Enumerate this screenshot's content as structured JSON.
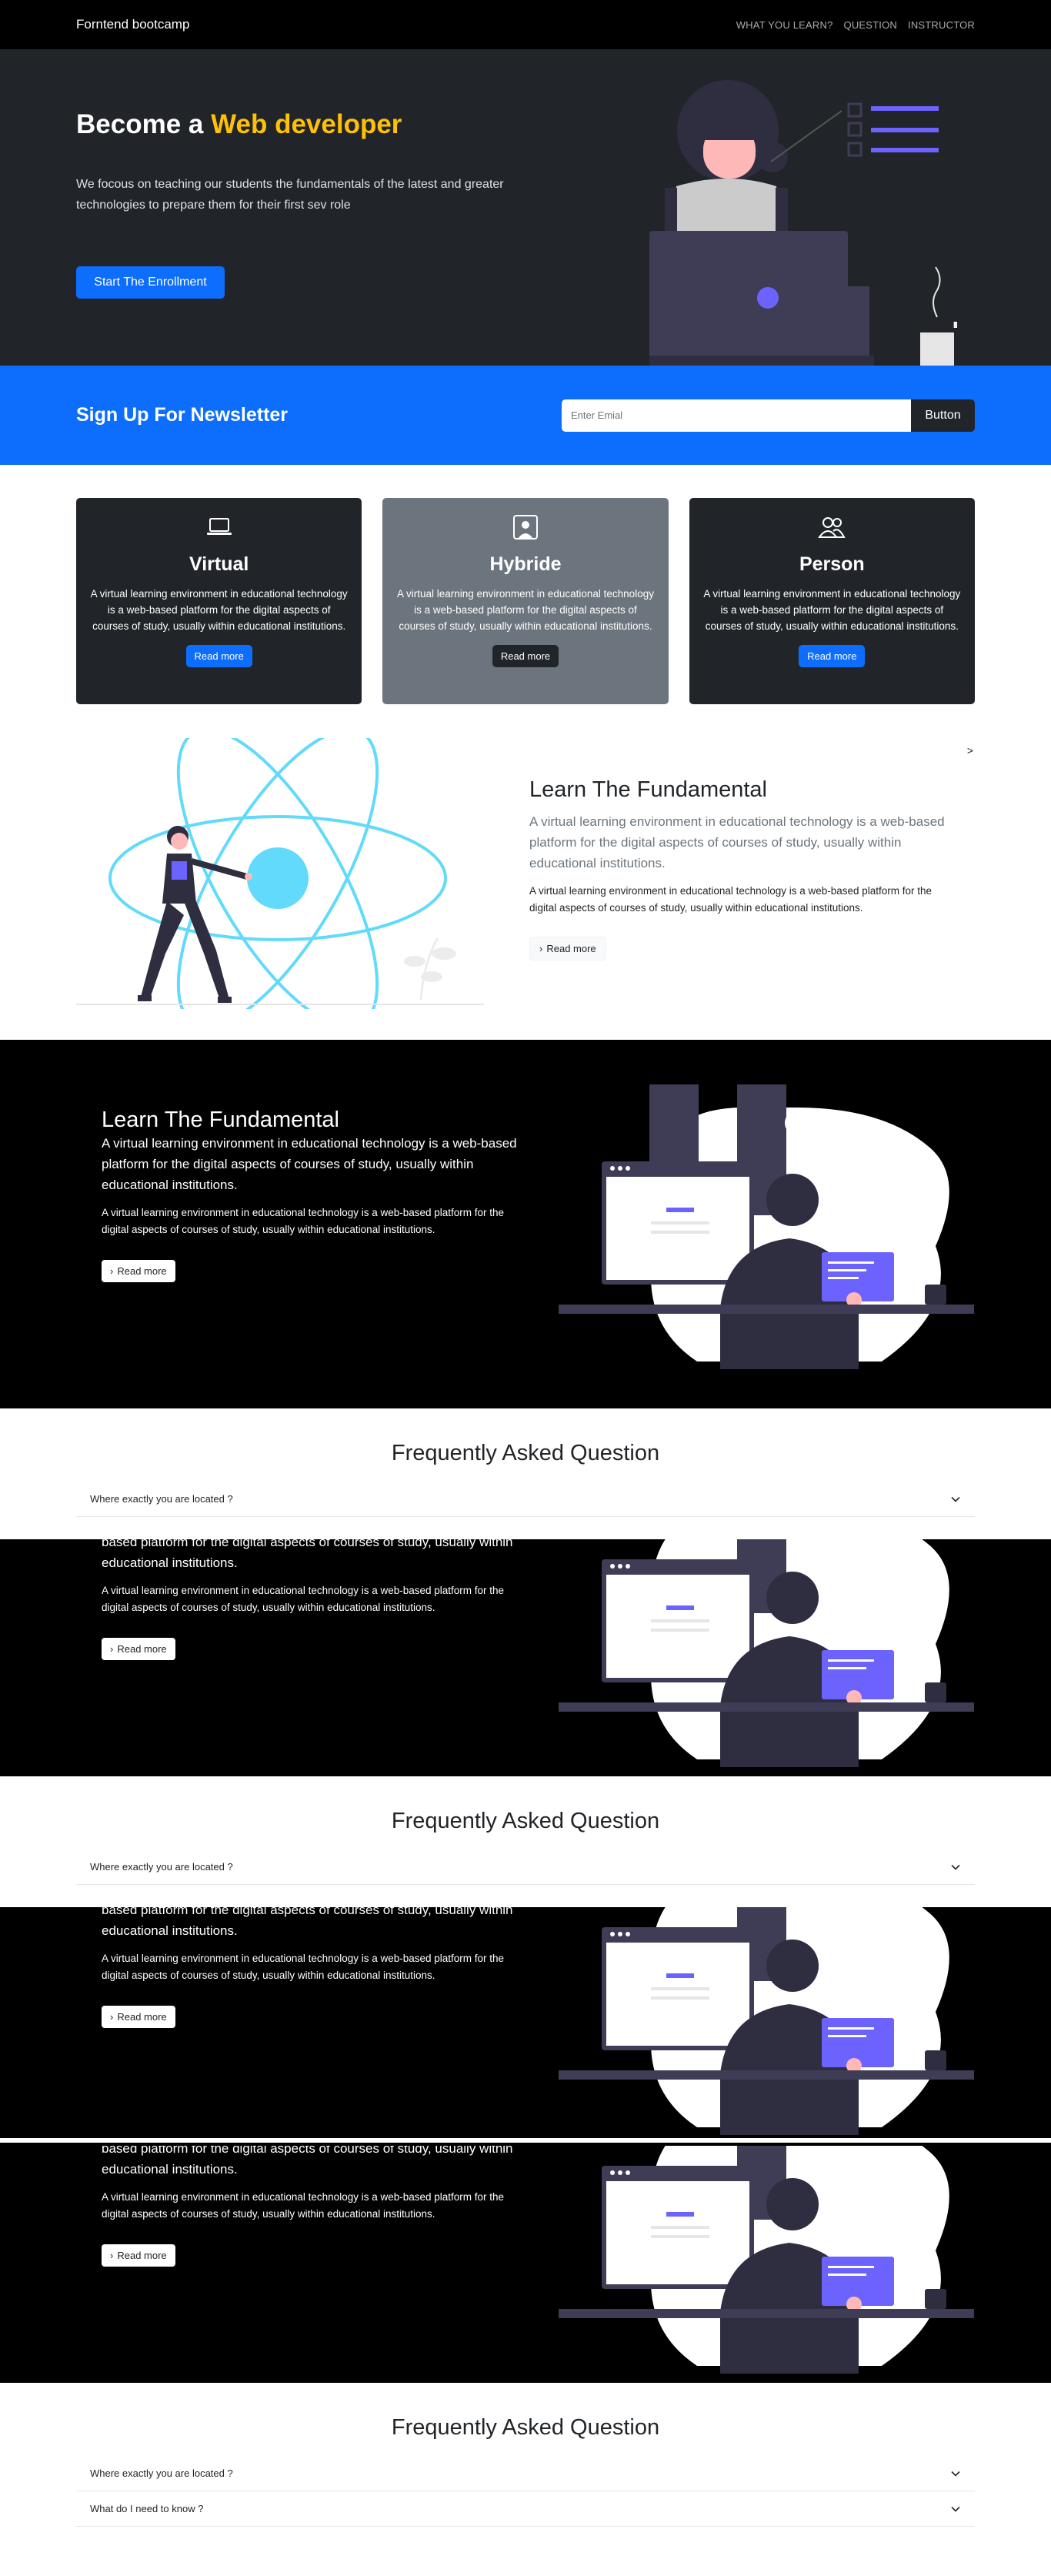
{
  "nav": {
    "brand": "Forntend bootcamp",
    "links": [
      "WHAT YOU LEARN?",
      "QUESTION",
      "INSTRUCTOR"
    ]
  },
  "hero": {
    "title_prefix": "Become a",
    "title_accent": "Web developer",
    "subtitle": "We focous on teaching our students the fundamentals of the latest and greater technologies to prepare them for their first sev role",
    "cta": "Start The Enrollment"
  },
  "newsletter": {
    "title": "Sign Up For Newsletter",
    "placeholder": "Enter Emial",
    "button": "Button"
  },
  "cards": [
    {
      "icon": "laptop-icon",
      "title": "Virtual",
      "text": "A virtual learning environment in educational technology is a web-based platform for the digital aspects of courses of study, usually within educational institutions.",
      "button": "Read more"
    },
    {
      "icon": "person-badge-icon",
      "title": "Hybride",
      "text": "A virtual learning environment in educational technology is a web-based platform for the digital aspects of courses of study, usually within educational institutions.",
      "button": "Read more"
    },
    {
      "icon": "people-icon",
      "title": "Person",
      "text": "A virtual learning environment in educational technology is a web-based platform for the digital aspects of courses of study, usually within educational institutions.",
      "button": "Read more"
    }
  ],
  "learn": {
    "title": "Learn The Fundamental",
    "lead": "A virtual learning environment in educational technology is a web-based platform for the digital aspects of courses of study, usually within educational institutions.",
    "text": "A virtual learning environment in educational technology is a web-based platform for the digital aspects of courses of study, usually within educational institutions.",
    "button": "Read more",
    "chevron": ">"
  },
  "learn_dark": {
    "title": "Learn The Fundamental",
    "lead": "A virtual learning environment in educational technology is a web-based platform for the digital aspects of courses of study, usually within educational institutions.",
    "text": "A virtual learning environment in educational technology is a web-based platform for the digital aspects of courses of study, usually within educational institutions.",
    "button": "Read more",
    "lead_partial": "based platform for the digital aspects of courses of study, usually within educational institutions."
  },
  "faq": {
    "title": "Frequently Asked Question",
    "items": [
      "Where exactly you are located ?",
      "What do I need to know ?"
    ]
  },
  "colors": {
    "primary": "#0d6efd",
    "accent": "#ffc107",
    "dark": "#212529",
    "illustration_purple": "#6c63ff",
    "react_blue": "#61dafb"
  }
}
